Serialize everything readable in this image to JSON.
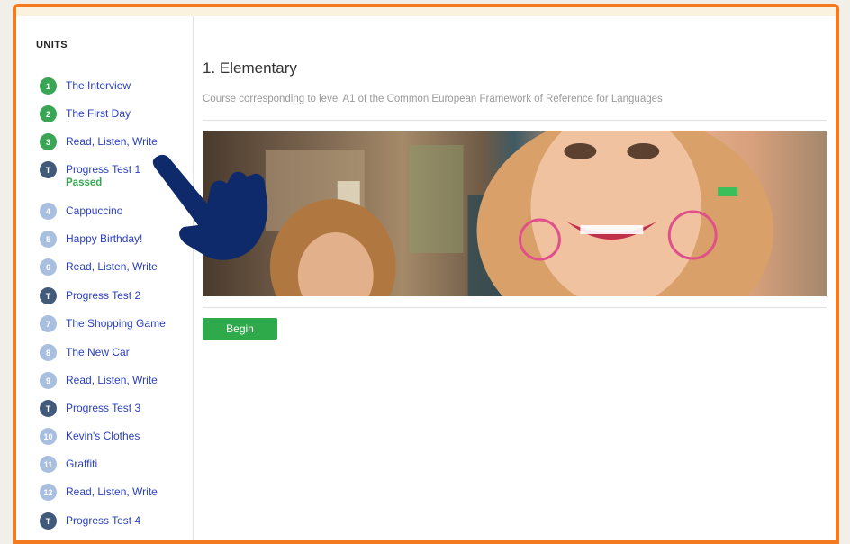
{
  "sidebar": {
    "title": "UNITS",
    "items": [
      {
        "badge": "1",
        "label": "The Interview",
        "state": "done"
      },
      {
        "badge": "2",
        "label": "The First Day",
        "state": "done"
      },
      {
        "badge": "3",
        "label": "Read, Listen, Write",
        "state": "done"
      },
      {
        "badge": "T",
        "label": "Progress Test 1",
        "state": "test",
        "status": "Passed"
      },
      {
        "badge": "4",
        "label": "Cappuccino",
        "state": "todo"
      },
      {
        "badge": "5",
        "label": "Happy Birthday!",
        "state": "todo"
      },
      {
        "badge": "6",
        "label": "Read, Listen, Write",
        "state": "todo"
      },
      {
        "badge": "T",
        "label": "Progress Test 2",
        "state": "test"
      },
      {
        "badge": "7",
        "label": "The Shopping Game",
        "state": "todo"
      },
      {
        "badge": "8",
        "label": "The New Car",
        "state": "todo"
      },
      {
        "badge": "9",
        "label": "Read, Listen, Write",
        "state": "todo"
      },
      {
        "badge": "T",
        "label": "Progress Test 3",
        "state": "test"
      },
      {
        "badge": "10",
        "label": "Kevin's Clothes",
        "state": "todo"
      },
      {
        "badge": "11",
        "label": "Graffiti",
        "state": "todo"
      },
      {
        "badge": "12",
        "label": "Read, Listen, Write",
        "state": "todo"
      },
      {
        "badge": "T",
        "label": "Progress Test 4",
        "state": "test"
      }
    ]
  },
  "main": {
    "title": "1. Elementary",
    "description": "Course corresponding to level A1 of the Common European Framework of Reference for Languages",
    "hero_image": "course-photo",
    "begin_label": "Begin"
  },
  "colors": {
    "frame": "#f47a1f",
    "done": "#3aa655",
    "todo": "#a9bfe0",
    "test": "#425a7a",
    "link": "#2a3fbf",
    "begin": "#2eaa4a",
    "pointer": "#0f2a6b"
  },
  "icons": {
    "pointer": "hand-pointer-icon"
  }
}
